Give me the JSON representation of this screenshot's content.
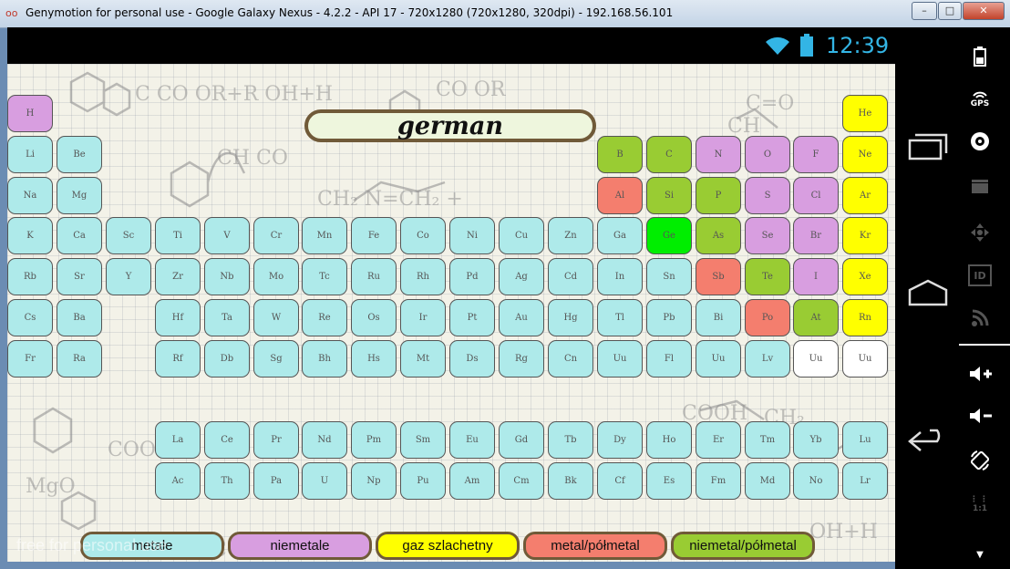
{
  "window": {
    "title": "Genymotion for personal use - Google Galaxy Nexus - 4.2.2 - API 17 - 720x1280 (720x1280, 320dpi) - 192.168.56.101"
  },
  "status": {
    "time": "12:39",
    "accent": "#33b5e5"
  },
  "quiz": {
    "word": "german"
  },
  "elements": [
    {
      "s": "H",
      "c": "nonmetal",
      "r": 0,
      "g": 0
    },
    {
      "s": "He",
      "c": "noble",
      "r": 0,
      "g": 17
    },
    {
      "s": "Li",
      "c": "metal",
      "r": 1,
      "g": 0
    },
    {
      "s": "Be",
      "c": "metal",
      "r": 1,
      "g": 1
    },
    {
      "s": "B",
      "c": "nonmetalloid",
      "r": 1,
      "g": 12
    },
    {
      "s": "C",
      "c": "nonmetalloid",
      "r": 1,
      "g": 13
    },
    {
      "s": "N",
      "c": "nonmetal",
      "r": 1,
      "g": 14
    },
    {
      "s": "O",
      "c": "nonmetal",
      "r": 1,
      "g": 15
    },
    {
      "s": "F",
      "c": "nonmetal",
      "r": 1,
      "g": 16
    },
    {
      "s": "Ne",
      "c": "noble",
      "r": 1,
      "g": 17
    },
    {
      "s": "Na",
      "c": "metal",
      "r": 2,
      "g": 0
    },
    {
      "s": "Mg",
      "c": "metal",
      "r": 2,
      "g": 1
    },
    {
      "s": "Al",
      "c": "metalloid",
      "r": 2,
      "g": 12
    },
    {
      "s": "Si",
      "c": "nonmetalloid",
      "r": 2,
      "g": 13
    },
    {
      "s": "P",
      "c": "nonmetalloid",
      "r": 2,
      "g": 14
    },
    {
      "s": "S",
      "c": "nonmetal",
      "r": 2,
      "g": 15
    },
    {
      "s": "Cl",
      "c": "nonmetal",
      "r": 2,
      "g": 16
    },
    {
      "s": "Ar",
      "c": "noble",
      "r": 2,
      "g": 17
    },
    {
      "s": "K",
      "c": "metal",
      "r": 3,
      "g": 0
    },
    {
      "s": "Ca",
      "c": "metal",
      "r": 3,
      "g": 1
    },
    {
      "s": "Sc",
      "c": "metal",
      "r": 3,
      "g": 2
    },
    {
      "s": "Ti",
      "c": "metal",
      "r": 3,
      "g": 3
    },
    {
      "s": "V",
      "c": "metal",
      "r": 3,
      "g": 4
    },
    {
      "s": "Cr",
      "c": "metal",
      "r": 3,
      "g": 5
    },
    {
      "s": "Mn",
      "c": "metal",
      "r": 3,
      "g": 6
    },
    {
      "s": "Fe",
      "c": "metal",
      "r": 3,
      "g": 7
    },
    {
      "s": "Co",
      "c": "metal",
      "r": 3,
      "g": 8
    },
    {
      "s": "Ni",
      "c": "metal",
      "r": 3,
      "g": 9
    },
    {
      "s": "Cu",
      "c": "metal",
      "r": 3,
      "g": 10
    },
    {
      "s": "Zn",
      "c": "metal",
      "r": 3,
      "g": 11
    },
    {
      "s": "Ga",
      "c": "metal",
      "r": 3,
      "g": 12
    },
    {
      "s": "Ge",
      "c": "ge",
      "r": 3,
      "g": 13
    },
    {
      "s": "As",
      "c": "nonmetalloid",
      "r": 3,
      "g": 14
    },
    {
      "s": "Se",
      "c": "nonmetal",
      "r": 3,
      "g": 15
    },
    {
      "s": "Br",
      "c": "nonmetal",
      "r": 3,
      "g": 16
    },
    {
      "s": "Kr",
      "c": "noble",
      "r": 3,
      "g": 17
    },
    {
      "s": "Rb",
      "c": "metal",
      "r": 4,
      "g": 0
    },
    {
      "s": "Sr",
      "c": "metal",
      "r": 4,
      "g": 1
    },
    {
      "s": "Y",
      "c": "metal",
      "r": 4,
      "g": 2
    },
    {
      "s": "Zr",
      "c": "metal",
      "r": 4,
      "g": 3
    },
    {
      "s": "Nb",
      "c": "metal",
      "r": 4,
      "g": 4
    },
    {
      "s": "Mo",
      "c": "metal",
      "r": 4,
      "g": 5
    },
    {
      "s": "Tc",
      "c": "metal",
      "r": 4,
      "g": 6
    },
    {
      "s": "Ru",
      "c": "metal",
      "r": 4,
      "g": 7
    },
    {
      "s": "Rh",
      "c": "metal",
      "r": 4,
      "g": 8
    },
    {
      "s": "Pd",
      "c": "metal",
      "r": 4,
      "g": 9
    },
    {
      "s": "Ag",
      "c": "metal",
      "r": 4,
      "g": 10
    },
    {
      "s": "Cd",
      "c": "metal",
      "r": 4,
      "g": 11
    },
    {
      "s": "In",
      "c": "metal",
      "r": 4,
      "g": 12
    },
    {
      "s": "Sn",
      "c": "metal",
      "r": 4,
      "g": 13
    },
    {
      "s": "Sb",
      "c": "metalloid",
      "r": 4,
      "g": 14
    },
    {
      "s": "Te",
      "c": "nonmetalloid",
      "r": 4,
      "g": 15
    },
    {
      "s": "I",
      "c": "nonmetal",
      "r": 4,
      "g": 16
    },
    {
      "s": "Xe",
      "c": "noble",
      "r": 4,
      "g": 17
    },
    {
      "s": "Cs",
      "c": "metal",
      "r": 5,
      "g": 0
    },
    {
      "s": "Ba",
      "c": "metal",
      "r": 5,
      "g": 1
    },
    {
      "s": "Hf",
      "c": "metal",
      "r": 5,
      "g": 3
    },
    {
      "s": "Ta",
      "c": "metal",
      "r": 5,
      "g": 4
    },
    {
      "s": "W",
      "c": "metal",
      "r": 5,
      "g": 5
    },
    {
      "s": "Re",
      "c": "metal",
      "r": 5,
      "g": 6
    },
    {
      "s": "Os",
      "c": "metal",
      "r": 5,
      "g": 7
    },
    {
      "s": "Ir",
      "c": "metal",
      "r": 5,
      "g": 8
    },
    {
      "s": "Pt",
      "c": "metal",
      "r": 5,
      "g": 9
    },
    {
      "s": "Au",
      "c": "metal",
      "r": 5,
      "g": 10
    },
    {
      "s": "Hg",
      "c": "metal",
      "r": 5,
      "g": 11
    },
    {
      "s": "Tl",
      "c": "metal",
      "r": 5,
      "g": 12
    },
    {
      "s": "Pb",
      "c": "metal",
      "r": 5,
      "g": 13
    },
    {
      "s": "Bi",
      "c": "metal",
      "r": 5,
      "g": 14
    },
    {
      "s": "Po",
      "c": "metalloid",
      "r": 5,
      "g": 15
    },
    {
      "s": "At",
      "c": "nonmetalloid",
      "r": 5,
      "g": 16
    },
    {
      "s": "Rn",
      "c": "noble",
      "r": 5,
      "g": 17
    },
    {
      "s": "Fr",
      "c": "metal",
      "r": 6,
      "g": 0
    },
    {
      "s": "Ra",
      "c": "metal",
      "r": 6,
      "g": 1
    },
    {
      "s": "Rf",
      "c": "metal",
      "r": 6,
      "g": 3
    },
    {
      "s": "Db",
      "c": "metal",
      "r": 6,
      "g": 4
    },
    {
      "s": "Sg",
      "c": "metal",
      "r": 6,
      "g": 5
    },
    {
      "s": "Bh",
      "c": "metal",
      "r": 6,
      "g": 6
    },
    {
      "s": "Hs",
      "c": "metal",
      "r": 6,
      "g": 7
    },
    {
      "s": "Mt",
      "c": "metal",
      "r": 6,
      "g": 8
    },
    {
      "s": "Ds",
      "c": "metal",
      "r": 6,
      "g": 9
    },
    {
      "s": "Rg",
      "c": "metal",
      "r": 6,
      "g": 10
    },
    {
      "s": "Cn",
      "c": "metal",
      "r": 6,
      "g": 11
    },
    {
      "s": "Uu",
      "c": "metal",
      "r": 6,
      "g": 12
    },
    {
      "s": "Fl",
      "c": "metal",
      "r": 6,
      "g": 13
    },
    {
      "s": "Uu",
      "c": "metal",
      "r": 6,
      "g": 14
    },
    {
      "s": "Lv",
      "c": "metal",
      "r": 6,
      "g": 15
    },
    {
      "s": "Uu",
      "c": "unknown",
      "r": 6,
      "g": 16
    },
    {
      "s": "Uu",
      "c": "unknown",
      "r": 6,
      "g": 17
    },
    {
      "s": "La",
      "c": "metal",
      "r": 8,
      "g": 3
    },
    {
      "s": "Ce",
      "c": "metal",
      "r": 8,
      "g": 4
    },
    {
      "s": "Pr",
      "c": "metal",
      "r": 8,
      "g": 5
    },
    {
      "s": "Nd",
      "c": "metal",
      "r": 8,
      "g": 6
    },
    {
      "s": "Pm",
      "c": "metal",
      "r": 8,
      "g": 7
    },
    {
      "s": "Sm",
      "c": "metal",
      "r": 8,
      "g": 8
    },
    {
      "s": "Eu",
      "c": "metal",
      "r": 8,
      "g": 9
    },
    {
      "s": "Gd",
      "c": "metal",
      "r": 8,
      "g": 10
    },
    {
      "s": "Tb",
      "c": "metal",
      "r": 8,
      "g": 11
    },
    {
      "s": "Dy",
      "c": "metal",
      "r": 8,
      "g": 12
    },
    {
      "s": "Ho",
      "c": "metal",
      "r": 8,
      "g": 13
    },
    {
      "s": "Er",
      "c": "metal",
      "r": 8,
      "g": 14
    },
    {
      "s": "Tm",
      "c": "metal",
      "r": 8,
      "g": 15
    },
    {
      "s": "Yb",
      "c": "metal",
      "r": 8,
      "g": 16
    },
    {
      "s": "Lu",
      "c": "metal",
      "r": 8,
      "g": 17
    },
    {
      "s": "Ac",
      "c": "metal",
      "r": 9,
      "g": 3
    },
    {
      "s": "Th",
      "c": "metal",
      "r": 9,
      "g": 4
    },
    {
      "s": "Pa",
      "c": "metal",
      "r": 9,
      "g": 5
    },
    {
      "s": "U",
      "c": "metal",
      "r": 9,
      "g": 6
    },
    {
      "s": "Np",
      "c": "metal",
      "r": 9,
      "g": 7
    },
    {
      "s": "Pu",
      "c": "metal",
      "r": 9,
      "g": 8
    },
    {
      "s": "Am",
      "c": "metal",
      "r": 9,
      "g": 9
    },
    {
      "s": "Cm",
      "c": "metal",
      "r": 9,
      "g": 10
    },
    {
      "s": "Bk",
      "c": "metal",
      "r": 9,
      "g": 11
    },
    {
      "s": "Cf",
      "c": "metal",
      "r": 9,
      "g": 12
    },
    {
      "s": "Es",
      "c": "metal",
      "r": 9,
      "g": 13
    },
    {
      "s": "Fm",
      "c": "metal",
      "r": 9,
      "g": 14
    },
    {
      "s": "Md",
      "c": "metal",
      "r": 9,
      "g": 15
    },
    {
      "s": "No",
      "c": "metal",
      "r": 9,
      "g": 16
    },
    {
      "s": "Lr",
      "c": "metal",
      "r": 9,
      "g": 17
    }
  ],
  "legend": [
    {
      "label": "metale",
      "c": "metal"
    },
    {
      "label": "niemetale",
      "c": "nonmetal"
    },
    {
      "label": "gaz szlachetny",
      "c": "noble"
    },
    {
      "label": "metal/półmetal",
      "c": "metalloid"
    },
    {
      "label": "niemetal/półmetal",
      "c": "nonmetalloid"
    }
  ],
  "colors": {
    "metal": "#aeeaea",
    "nonmetal": "#d89ee0",
    "noble": "#ffff00",
    "metalloid": "#f47e6e",
    "nonmetalloid": "#99cc33",
    "ge": "#00ee00",
    "unknown": "#ffffff",
    "frame": "#705a38"
  },
  "watermark": "free for personal use",
  "sidebar_icons": [
    "battery-icon",
    "gps-icon",
    "camera-icon",
    "clapper-icon",
    "dpad-icon",
    "id-icon",
    "cast-icon",
    "volume-up-icon",
    "volume-down-icon",
    "rotate-icon",
    "pixel-perfect-icon",
    "chevron-down-icon"
  ],
  "sidebar_labels": {
    "gps": "GPS",
    "id": "ID",
    "pixel": "1:1"
  }
}
